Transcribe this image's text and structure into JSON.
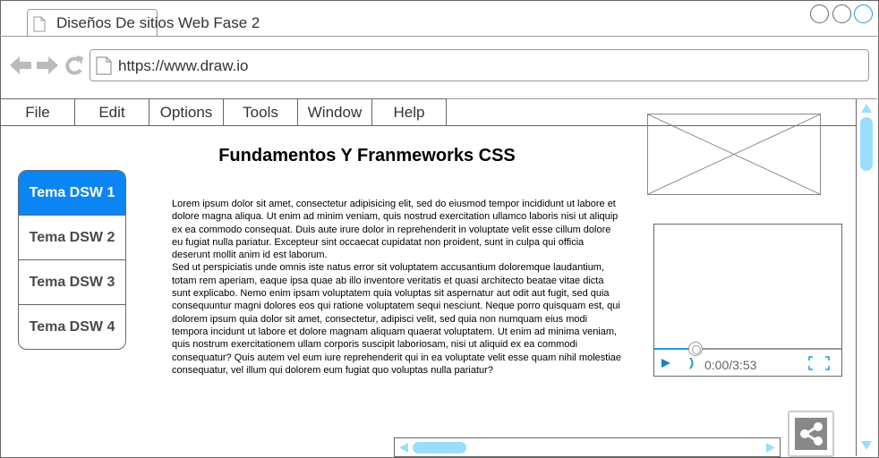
{
  "browser": {
    "tab_title": "Diseños De sitios Web Fase 2",
    "url": "https://www.draw.io"
  },
  "menu": {
    "items": [
      "File",
      "Edit",
      "Options",
      "Tools",
      "Window",
      "Help"
    ]
  },
  "sidebar": {
    "items": [
      {
        "label": "Tema DSW 1",
        "active": true
      },
      {
        "label": "Tema DSW 2",
        "active": false
      },
      {
        "label": "Tema DSW 3",
        "active": false
      },
      {
        "label": "Tema DSW 4",
        "active": false
      }
    ]
  },
  "main": {
    "title": "Fundamentos Y Franmeworks CSS",
    "paragraphs": [
      "Lorem ipsum dolor sit amet, consectetur adipisicing elit, sed do eiusmod tempor incididunt ut labore et dolore magna aliqua. Ut enim ad minim veniam, quis nostrud exercitation ullamco laboris nisi ut aliquip ex ea commodo consequat. Duis aute irure dolor in reprehenderit in voluptate velit esse cillum dolore eu fugiat nulla pariatur. Excepteur sint occaecat cupidatat non proident, sunt in culpa qui officia deserunt mollit anim id est laborum.",
      "Sed ut perspiciatis unde omnis iste natus error sit voluptatem accusantium doloremque laudantium, totam rem aperiam, eaque ipsa quae ab illo inventore veritatis et quasi architecto beatae vitae dicta sunt explicabo. Nemo enim ipsam voluptatem quia voluptas sit aspernatur aut odit aut fugit, sed quia consequuntur magni dolores eos qui ratione voluptatem sequi nesciunt. Neque porro quisquam est, qui dolorem ipsum quia dolor sit amet, consectetur, adipisci velit, sed quia non numquam eius modi tempora incidunt ut labore et dolore magnam aliquam quaerat voluptatem. Ut enim ad minima veniam, quis nostrum exercitationem ullam corporis suscipit laboriosam, nisi ut aliquid ex ea commodi consequatur? Quis autem vel eum iure reprehenderit qui in ea voluptate velit esse quam nihil molestiae consequatur, vel illum qui dolorem eum fugiat quo voluptas nulla pariatur?"
    ]
  },
  "video": {
    "time": "0:00/3:53",
    "progress": 0.22
  },
  "icons": {
    "back": "back-arrow-icon",
    "forward": "forward-arrow-icon",
    "reload": "reload-icon",
    "page": "page-icon",
    "image_placeholder": "image-placeholder-icon",
    "play": "play-icon",
    "volume": "volume-icon",
    "fullscreen": "fullscreen-icon",
    "share": "share-icon"
  },
  "colors": {
    "accent": "#0c85f4",
    "scroll_thumb": "#99ddff",
    "window_button_highlight": "#1a9bd7"
  }
}
